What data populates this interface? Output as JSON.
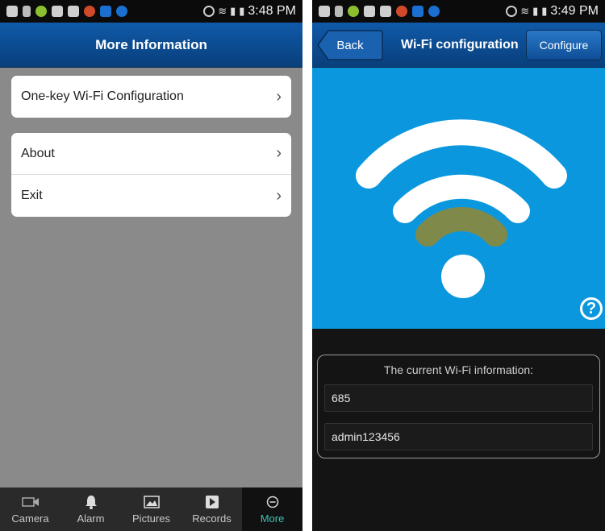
{
  "left": {
    "status": {
      "time": "3:48 PM"
    },
    "title": "More Information",
    "menu_group_1": [
      {
        "label": "One-key Wi-Fi Configuration"
      }
    ],
    "menu_group_2": [
      {
        "label": "About"
      },
      {
        "label": "Exit"
      }
    ],
    "tabs": [
      {
        "label": "Camera",
        "icon": "camera-icon"
      },
      {
        "label": "Alarm",
        "icon": "bell-icon"
      },
      {
        "label": "Pictures",
        "icon": "picture-icon"
      },
      {
        "label": "Records",
        "icon": "records-icon"
      },
      {
        "label": "More",
        "icon": "more-icon",
        "active": true
      }
    ],
    "colors": {
      "header": "#0f5aa8",
      "background": "#8a8a8a",
      "active_tab": "#3fc0b0"
    }
  },
  "right": {
    "status": {
      "time": "3:49 PM"
    },
    "back_label": "Back",
    "title": "Wi-Fi configuration",
    "configure_label": "Configure",
    "help_label": "?",
    "info_label": "The current Wi-Fi information:",
    "ssid_value": "685",
    "password_value": "admin123456",
    "colors": {
      "wifi_panel": "#0b97de",
      "wifi_signal_partial": "#7f8a4a"
    }
  }
}
